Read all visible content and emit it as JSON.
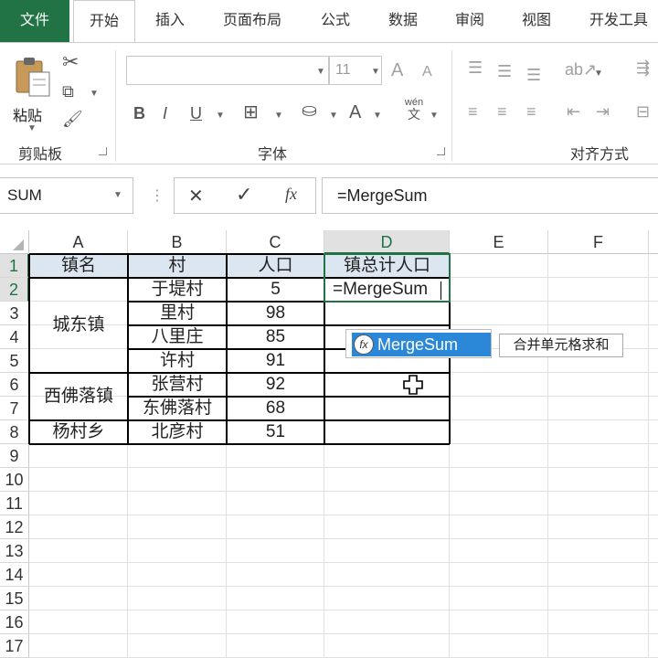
{
  "tabs": [
    "文件",
    "开始",
    "插入",
    "页面布局",
    "公式",
    "数据",
    "审阅",
    "视图",
    "开发工具"
  ],
  "ribbon": {
    "paste_label": "粘贴",
    "clipboard_label": "剪贴板",
    "font_label": "字体",
    "align_label": "对齐方式",
    "font_size": "11",
    "bold": "B",
    "italic": "I",
    "underline": "U",
    "grow": "A",
    "shrink": "A",
    "font_color": "A",
    "wen": "wén",
    "wen_sub": "文"
  },
  "namebox": "SUM",
  "formula_bar": {
    "cancel": "✕",
    "enter": "✓",
    "fx": "fx",
    "content": "=MergeSum"
  },
  "columns": [
    "A",
    "B",
    "C",
    "D",
    "E",
    "F"
  ],
  "rows": [
    "1",
    "2",
    "3",
    "4",
    "5",
    "6",
    "7",
    "8",
    "9",
    "10",
    "11",
    "12",
    "13",
    "14",
    "15",
    "16",
    "17"
  ],
  "table": {
    "headers": [
      "镇名",
      "村",
      "人口",
      "镇总计人口"
    ],
    "towns": [
      "城东镇",
      "西佛落镇",
      "杨村乡"
    ],
    "villages": [
      "于堤村",
      "里村",
      "八里庄",
      "许村",
      "张营村",
      "东佛落村",
      "北彦村"
    ],
    "population": [
      "5",
      "98",
      "85",
      "91",
      "92",
      "68",
      "51"
    ],
    "editing_text": "=MergeSum"
  },
  "autocomplete": {
    "item": "MergeSum",
    "tooltip": "合并单元格求和"
  }
}
